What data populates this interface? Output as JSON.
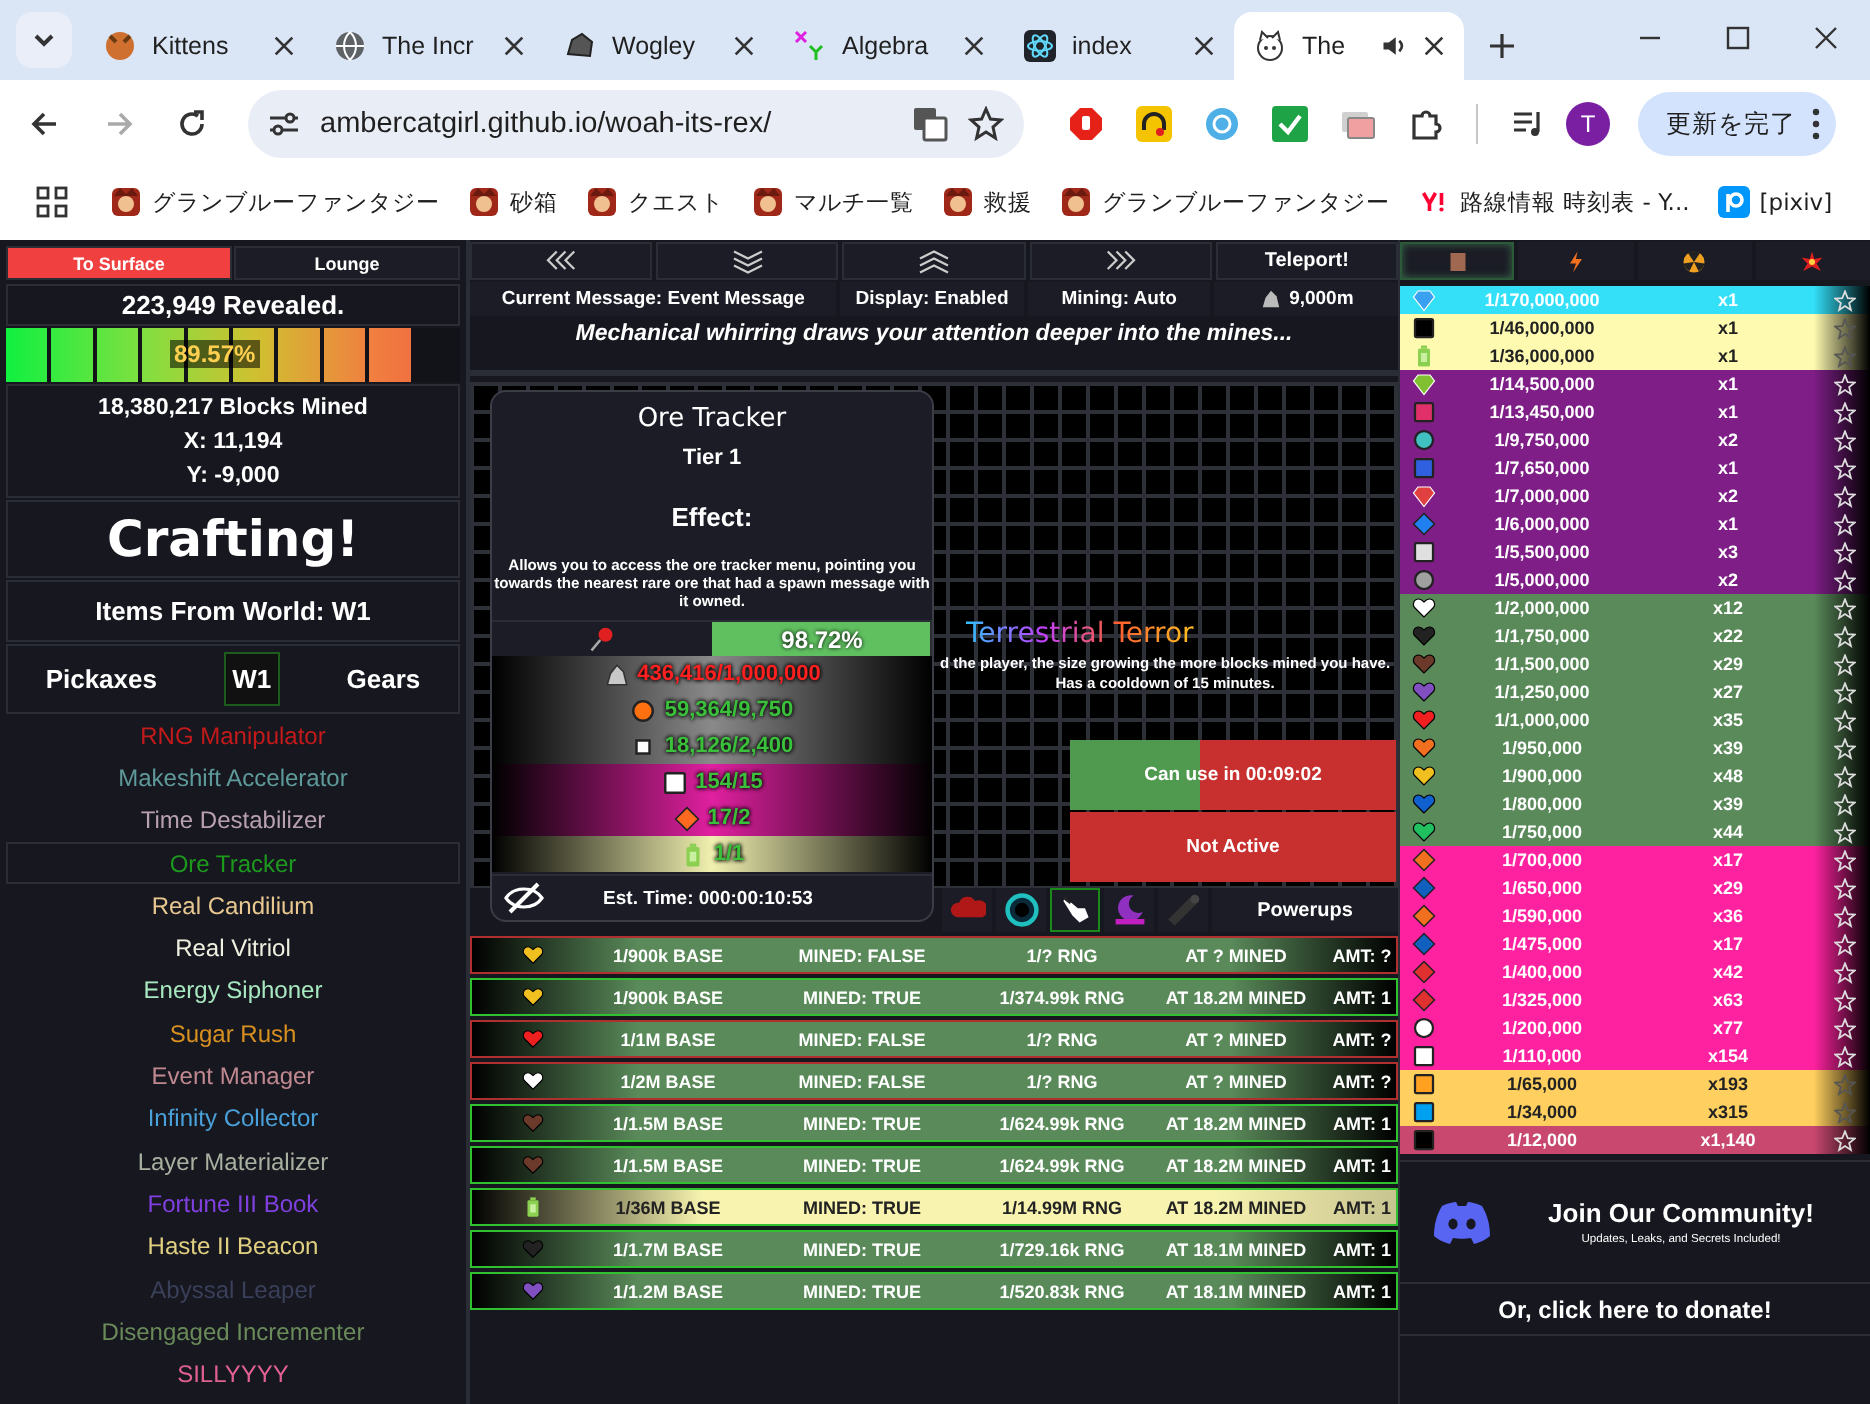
{
  "browser": {
    "tabs": [
      {
        "title": "Kittens",
        "selected": false
      },
      {
        "title": "The Incr",
        "selected": false
      },
      {
        "title": "Wogley",
        "selected": false
      },
      {
        "title": "Algebra",
        "selected": false
      },
      {
        "title": "index",
        "selected": false
      },
      {
        "title": "The",
        "selected": true
      }
    ],
    "url": "ambercatgirl.github.io/woah-its-rex/",
    "profile": "T",
    "update_button": "更新を完了",
    "bookmarks": [
      "グランブルーファンタジー",
      "砂箱",
      "クエスト",
      "マルチ一覧",
      "救援",
      "グランブルーファンタジー",
      "路線情報 時刻表 - Y...",
      "[pixiv]"
    ]
  },
  "left": {
    "nav": [
      {
        "label": "To Surface",
        "selected": true
      },
      {
        "label": "Lounge",
        "selected": false
      }
    ],
    "revealed": "223,949 Revealed.",
    "progress": {
      "level": 0.9,
      "label": "89.57%"
    },
    "blocks_mined": "18,380,217 Blocks Mined",
    "x": "X: 11,194",
    "y": "Y: -9,000",
    "heading": "Crafting!",
    "world": "Items From World: W1",
    "categories": [
      {
        "label": "Pickaxes",
        "selected": false
      },
      {
        "label": "W1",
        "selected": true
      },
      {
        "label": "Gears",
        "selected": false
      }
    ],
    "items": [
      {
        "name": "RNG Manipulator",
        "color": "#c41a1a",
        "selected": false
      },
      {
        "name": "Makeshift Accelerator",
        "color": "#5e9a9a",
        "selected": false
      },
      {
        "name": "Time Destabilizer",
        "color": "#b8a0b0",
        "selected": false
      },
      {
        "name": "Ore Tracker",
        "color": "#1d9a1d",
        "selected": true
      },
      {
        "name": "Real Candilium",
        "color": "#e8c890",
        "selected": false
      },
      {
        "name": "Real Vitriol",
        "color": "#f0f0e0",
        "selected": false
      },
      {
        "name": "Energy Siphoner",
        "color": "#a8e8c0",
        "selected": false
      },
      {
        "name": "Sugar Rush",
        "color": "#d89020",
        "selected": false
      },
      {
        "name": "Event Manager",
        "color": "#c08890",
        "selected": false
      },
      {
        "name": "Infinity Collector",
        "color": "#4aa0d8",
        "selected": false
      },
      {
        "name": "Layer Materializer",
        "color": "#a8b0a0",
        "selected": false
      },
      {
        "name": "Fortune III Book",
        "color": "#8040e0",
        "selected": false
      },
      {
        "name": "Haste II Beacon",
        "color": "#e0d080",
        "selected": false
      },
      {
        "name": "Abyssal Leaper",
        "color": "#3a3f5a",
        "selected": false
      },
      {
        "name": "Disengaged Incrementer",
        "color": "#6a8a5a",
        "selected": false
      },
      {
        "name": "SILLYYYY",
        "color": "#e06090",
        "selected": false
      }
    ]
  },
  "middle": {
    "nav_buttons": [
      {
        "kind": "left"
      },
      {
        "kind": "down"
      },
      {
        "kind": "up"
      },
      {
        "kind": "right"
      },
      {
        "kind": "text",
        "label": "Teleport!"
      }
    ],
    "current_message": "Current Message: Event Message",
    "display": "Display: Enabled",
    "mining": "Mining: Auto",
    "depth": "9,000m",
    "message": "Mechanical whirring draws your attention deeper into the mines...",
    "popup": {
      "title": "Ore Tracker",
      "tier": "Tier 1",
      "effect_heading": "Effect:",
      "description": "Allows you to access the ore tracker menu, pointing you towards the nearest rare ore that had a spawn message with it owned.",
      "progress": {
        "level": 0.9872,
        "label": "98.72%"
      },
      "requirements": [
        {
          "kind": "rock",
          "amount": "436,416/1,000,000",
          "met": false,
          "color": "#8a8a8a"
        },
        {
          "kind": "circle",
          "amount": "59,364/9,750",
          "met": true,
          "color": "#8a8a8a"
        },
        {
          "kind": "small-square",
          "amount": "18,126/2,400",
          "met": true,
          "color": "#8a8a8a"
        },
        {
          "kind": "square",
          "amount": "154/15",
          "met": true,
          "color": "#e020a0"
        },
        {
          "kind": "diamond",
          "amount": "17/2",
          "met": true,
          "color": "#e020a0"
        },
        {
          "kind": "battery",
          "amount": "1/1",
          "met": true,
          "color": "#f0f0b0"
        }
      ],
      "est_time": "Est. Time: 000:00:10:53"
    },
    "event_title": "Terrestrial Terror",
    "event_text": "d the player, the size growing the more blocks mined you have. Has a cooldown of 15 minutes.",
    "cooldown_button": {
      "label": "Can use in 00:09:02",
      "level": 0.4
    },
    "status_button": "Not Active",
    "powerups": [
      {
        "kind": "cloud",
        "selected": false
      },
      {
        "kind": "ring",
        "selected": false
      },
      {
        "kind": "hand",
        "selected": true
      },
      {
        "kind": "moon",
        "selected": false
      },
      {
        "kind": "rod",
        "selected": false
      }
    ],
    "powerups_label": "Powerups",
    "rows": [
      {
        "kind": "heart",
        "color": "#f0c020",
        "base": "1/900k BASE",
        "mined": "MINED: FALSE",
        "found": false,
        "rng": "1/? RNG",
        "at": "AT ? MINED",
        "amt": "AMT: ?",
        "highlighted": false
      },
      {
        "kind": "heart",
        "color": "#f0c020",
        "base": "1/900k BASE",
        "mined": "MINED: TRUE",
        "found": true,
        "rng": "1/374.99k RNG",
        "at": "AT 18.2M MINED",
        "amt": "AMT: 1",
        "highlighted": false
      },
      {
        "kind": "heart",
        "color": "#f02020",
        "base": "1/1M BASE",
        "mined": "MINED: FALSE",
        "found": false,
        "rng": "1/? RNG",
        "at": "AT ? MINED",
        "amt": "AMT: ?",
        "highlighted": false
      },
      {
        "kind": "heart",
        "color": "#ffffff",
        "base": "1/2M BASE",
        "mined": "MINED: FALSE",
        "found": false,
        "rng": "1/? RNG",
        "at": "AT ? MINED",
        "amt": "AMT: ?",
        "highlighted": false
      },
      {
        "kind": "heart",
        "color": "#6b3a2a",
        "base": "1/1.5M BASE",
        "mined": "MINED: TRUE",
        "found": true,
        "rng": "1/624.99k RNG",
        "at": "AT 18.2M MINED",
        "amt": "AMT: 1",
        "highlighted": false
      },
      {
        "kind": "heart",
        "color": "#6b3a2a",
        "base": "1/1.5M BASE",
        "mined": "MINED: TRUE",
        "found": true,
        "rng": "1/624.99k RNG",
        "at": "AT 18.2M MINED",
        "amt": "AMT: 1",
        "highlighted": false
      },
      {
        "kind": "battery",
        "color": "#8bd050",
        "base": "1/36M BASE",
        "mined": "MINED: TRUE",
        "found": true,
        "rng": "1/14.99M RNG",
        "at": "AT 18.2M MINED",
        "amt": "AMT: 1",
        "highlighted": true
      },
      {
        "kind": "heart",
        "color": "#222222",
        "base": "1/1.7M BASE",
        "mined": "MINED: TRUE",
        "found": true,
        "rng": "1/729.16k RNG",
        "at": "AT 18.1M MINED",
        "amt": "AMT: 1",
        "highlighted": false
      },
      {
        "kind": "heart",
        "color": "#8050c0",
        "base": "1/1.2M BASE",
        "mined": "MINED: TRUE",
        "found": true,
        "rng": "1/520.83k RNG",
        "at": "AT 18.1M MINED",
        "amt": "AMT: 1",
        "highlighted": false
      }
    ]
  },
  "right": {
    "tabs": [
      {
        "kind": "block",
        "selected": true
      },
      {
        "kind": "bolt",
        "selected": false
      },
      {
        "kind": "radiation",
        "selected": false
      },
      {
        "kind": "burst",
        "selected": false
      }
    ],
    "tiers": [
      {
        "color": "#33e0f8",
        "ores": [
          {
            "kind": "gem",
            "color": "#3aa0f0",
            "rarity": "1/170,000,000",
            "count": "x1"
          }
        ]
      },
      {
        "color": "#fefbb0",
        "ores": [
          {
            "kind": "square",
            "color": "#000000",
            "rarity": "1/46,000,000",
            "count": "x1"
          },
          {
            "kind": "battery",
            "color": "#8bd050",
            "rarity": "1/36,000,000",
            "count": "x1"
          }
        ]
      },
      {
        "color": "#7e1e86",
        "ores": [
          {
            "kind": "gem",
            "color": "#80c030",
            "rarity": "1/14,500,000",
            "count": "x1"
          },
          {
            "kind": "square",
            "color": "#e0306a",
            "rarity": "1/13,450,000",
            "count": "x1"
          },
          {
            "kind": "circle",
            "color": "#40c0c0",
            "rarity": "1/9,750,000",
            "count": "x2"
          },
          {
            "kind": "square",
            "color": "#3060e0",
            "rarity": "1/7,650,000",
            "count": "x1"
          },
          {
            "kind": "gem",
            "color": "#e04040",
            "rarity": "1/7,000,000",
            "count": "x2"
          },
          {
            "kind": "diamond",
            "color": "#2080f0",
            "rarity": "1/6,000,000",
            "count": "x1"
          },
          {
            "kind": "square",
            "color": "#e0e0e0",
            "rarity": "1/5,500,000",
            "count": "x3"
          },
          {
            "kind": "circle",
            "color": "#a0a0a0",
            "rarity": "1/5,000,000",
            "count": "x2"
          }
        ]
      },
      {
        "color": "#5a8a5a",
        "ores": [
          {
            "kind": "heart",
            "color": "#ffffff",
            "rarity": "1/2,000,000",
            "count": "x12"
          },
          {
            "kind": "heart",
            "color": "#222222",
            "rarity": "1/1,750,000",
            "count": "x22"
          },
          {
            "kind": "heart",
            "color": "#6b3a2a",
            "rarity": "1/1,500,000",
            "count": "x29"
          },
          {
            "kind": "heart",
            "color": "#8050c0",
            "rarity": "1/1,250,000",
            "count": "x27"
          },
          {
            "kind": "heart",
            "color": "#f02020",
            "rarity": "1/1,000,000",
            "count": "x35"
          },
          {
            "kind": "heart",
            "color": "#f07020",
            "rarity": "1/950,000",
            "count": "x39"
          },
          {
            "kind": "heart",
            "color": "#f0c020",
            "rarity": "1/900,000",
            "count": "x48"
          },
          {
            "kind": "heart",
            "color": "#1060d0",
            "rarity": "1/800,000",
            "count": "x39"
          },
          {
            "kind": "heart",
            "color": "#20c060",
            "rarity": "1/750,000",
            "count": "x44"
          }
        ]
      },
      {
        "color": "#ff22a0",
        "ores": [
          {
            "kind": "diamond",
            "color": "#f07020",
            "rarity": "1/700,000",
            "count": "x17"
          },
          {
            "kind": "diamond",
            "color": "#1060c0",
            "rarity": "1/650,000",
            "count": "x29"
          },
          {
            "kind": "diamond",
            "color": "#f07020",
            "rarity": "1/590,000",
            "count": "x36"
          },
          {
            "kind": "diamond",
            "color": "#1060c0",
            "rarity": "1/475,000",
            "count": "x17"
          },
          {
            "kind": "diamond",
            "color": "#e03030",
            "rarity": "1/400,000",
            "count": "x42"
          },
          {
            "kind": "diamond",
            "color": "#e03030",
            "rarity": "1/325,000",
            "count": "x63"
          },
          {
            "kind": "circle",
            "color": "#ffffff",
            "rarity": "1/200,000",
            "count": "x77"
          },
          {
            "kind": "square",
            "color": "#ffffff",
            "rarity": "1/110,000",
            "count": "x154"
          }
        ]
      },
      {
        "color": "#ffd060",
        "ores": [
          {
            "kind": "square",
            "color": "#ffa020",
            "rarity": "1/65,000",
            "count": "x193"
          },
          {
            "kind": "square",
            "color": "#00a0f0",
            "rarity": "1/34,000",
            "count": "x315"
          }
        ]
      },
      {
        "color": "#c84870",
        "ores": [
          {
            "kind": "square",
            "color": "#000000",
            "rarity": "1/12,000",
            "count": "x1,140"
          }
        ]
      }
    ],
    "community_title": "Join Our Community!",
    "community_subtitle": "Updates, Leaks, and Secrets Included!",
    "donate": "Or, click here to donate!"
  }
}
